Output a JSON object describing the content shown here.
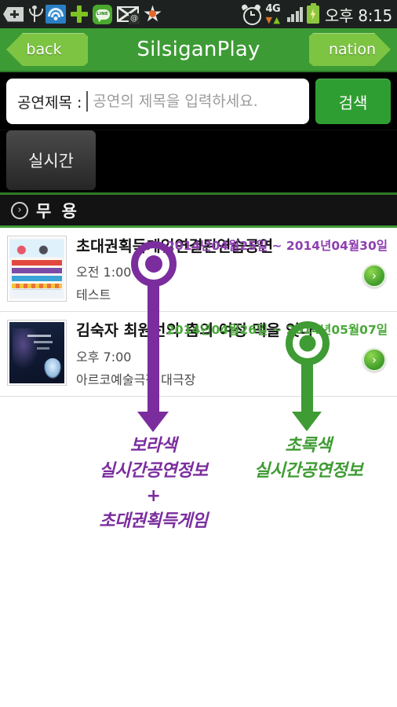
{
  "statusbar": {
    "icons": [
      "back-arrow-icon",
      "usb-icon",
      "wifi-icon",
      "plus-icon",
      "line-app-icon",
      "mail-icon",
      "star-icon",
      "alarm-icon",
      "4g-data-icon",
      "signal-bars-icon",
      "battery-charging-icon"
    ],
    "network_label": "4G",
    "time": "오후 8:15"
  },
  "appbar": {
    "back_label": "back",
    "title": "SilsiganPlay",
    "nation_label": "nation"
  },
  "search": {
    "label": "공연제목 :",
    "value": "",
    "placeholder": "공연의 제목을 입력하세요.",
    "button_label": "검색"
  },
  "tabs": [
    {
      "label": "실시간",
      "selected": true
    }
  ],
  "section": {
    "title": "무 용",
    "chevron": "›"
  },
  "list": [
    {
      "thumb": "game-poster-thumbnail",
      "title": "초대권획득게임연결된연습공연",
      "time": "오전 1:00",
      "place": "테스트",
      "date": "2014년04월25일 ~ 2014년04월30일",
      "date_color": "#8e3fb0",
      "go": "›"
    },
    {
      "thumb": "dance-poster-thumbnail",
      "title": "김숙자 최원선의 춤의 여정 맥을 잇다",
      "time": "오후 7:00",
      "place": "아르코예술극장 대극장",
      "date": "2014년04월26일 ~ 2014년05월07일",
      "date_color": "#4aa83a",
      "go": "›"
    }
  ],
  "annotations": [
    {
      "name": "purple-annotation",
      "color": "#7b2d9e",
      "lines": [
        "보라색",
        "실시간공연정보",
        "+",
        "초대권획득게임"
      ]
    },
    {
      "name": "green-annotation",
      "color": "#3f9b33",
      "lines": [
        "초록색",
        "실시간공연정보"
      ]
    }
  ],
  "colors": {
    "brand_green": "#3d9b35",
    "light_green": "#7cc442",
    "search_button": "#2f9e32",
    "purple": "#7b2d9e",
    "annotation_green": "#3f9b33"
  }
}
